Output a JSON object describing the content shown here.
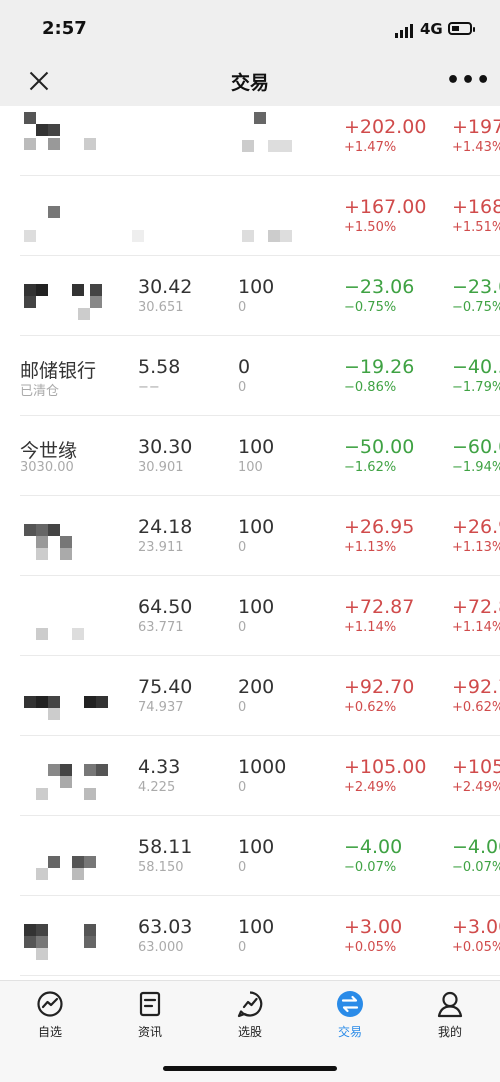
{
  "status_bar": {
    "time": "2:57",
    "network": "4G"
  },
  "nav": {
    "title": "交易"
  },
  "rows": [
    {
      "name": "",
      "sub": "",
      "price": "",
      "cost": "",
      "qty": "",
      "avail": "",
      "pl": "+202.00",
      "pl_pct": "+1.47%",
      "total_pl": "+197.",
      "total_pl_pct": "+1.43%",
      "trend": "up"
    },
    {
      "name": "",
      "sub": "",
      "price": "",
      "cost": "",
      "qty": "",
      "avail": "",
      "pl": "+167.00",
      "pl_pct": "+1.50%",
      "total_pl": "+168.",
      "total_pl_pct": "+1.51%",
      "trend": "up"
    },
    {
      "name": "",
      "sub": "",
      "price": "30.42",
      "cost": "30.651",
      "qty": "100",
      "avail": "0",
      "pl": "−23.06",
      "pl_pct": "−0.75%",
      "total_pl": "−23.0",
      "total_pl_pct": "−0.75%",
      "trend": "down"
    },
    {
      "name": "邮储银行",
      "sub": "已清仓",
      "price": "5.58",
      "cost": "−−",
      "qty": "0",
      "avail": "0",
      "pl": "−19.26",
      "pl_pct": "−0.86%",
      "total_pl": "−40.3",
      "total_pl_pct": "−1.79%",
      "trend": "down"
    },
    {
      "name": "今世缘",
      "sub": "3030.00",
      "price": "30.30",
      "cost": "30.901",
      "qty": "100",
      "avail": "100",
      "pl": "−50.00",
      "pl_pct": "−1.62%",
      "total_pl": "−60.0",
      "total_pl_pct": "−1.94%",
      "trend": "down"
    },
    {
      "name": "",
      "sub": "",
      "price": "24.18",
      "cost": "23.911",
      "qty": "100",
      "avail": "0",
      "pl": "+26.95",
      "pl_pct": "+1.13%",
      "total_pl": "+26.9",
      "total_pl_pct": "+1.13%",
      "trend": "up"
    },
    {
      "name": "",
      "sub": "",
      "price": "64.50",
      "cost": "63.771",
      "qty": "100",
      "avail": "0",
      "pl": "+72.87",
      "pl_pct": "+1.14%",
      "total_pl": "+72.8",
      "total_pl_pct": "+1.14%",
      "trend": "up"
    },
    {
      "name": "",
      "sub": "",
      "price": "75.40",
      "cost": "74.937",
      "qty": "200",
      "avail": "0",
      "pl": "+92.70",
      "pl_pct": "+0.62%",
      "total_pl": "+92.7",
      "total_pl_pct": "+0.62%",
      "trend": "up"
    },
    {
      "name": "",
      "sub": "",
      "price": "4.33",
      "cost": "4.225",
      "qty": "1000",
      "avail": "0",
      "pl": "+105.00",
      "pl_pct": "+2.49%",
      "total_pl": "+105.",
      "total_pl_pct": "+2.49%",
      "trend": "up"
    },
    {
      "name": "",
      "sub": "",
      "price": "58.11",
      "cost": "58.150",
      "qty": "100",
      "avail": "0",
      "pl": "−4.00",
      "pl_pct": "−0.07%",
      "total_pl": "−4.00",
      "total_pl_pct": "−0.07%",
      "trend": "down"
    },
    {
      "name": "",
      "sub": "",
      "price": "63.03",
      "cost": "63.000",
      "qty": "100",
      "avail": "0",
      "pl": "+3.00",
      "pl_pct": "+0.05%",
      "total_pl": "+3.00",
      "total_pl_pct": "+0.05%",
      "trend": "up"
    }
  ],
  "tabs": [
    {
      "label": "自选",
      "icon": "watchlist-chart-icon"
    },
    {
      "label": "资讯",
      "icon": "news-icon"
    },
    {
      "label": "选股",
      "icon": "stock-picker-icon"
    },
    {
      "label": "交易",
      "icon": "trade-exchange-icon"
    },
    {
      "label": "我的",
      "icon": "profile-icon"
    }
  ],
  "colors": {
    "up": "#d04b4b",
    "down": "#3fa243",
    "active_tab": "#2a8be8"
  }
}
